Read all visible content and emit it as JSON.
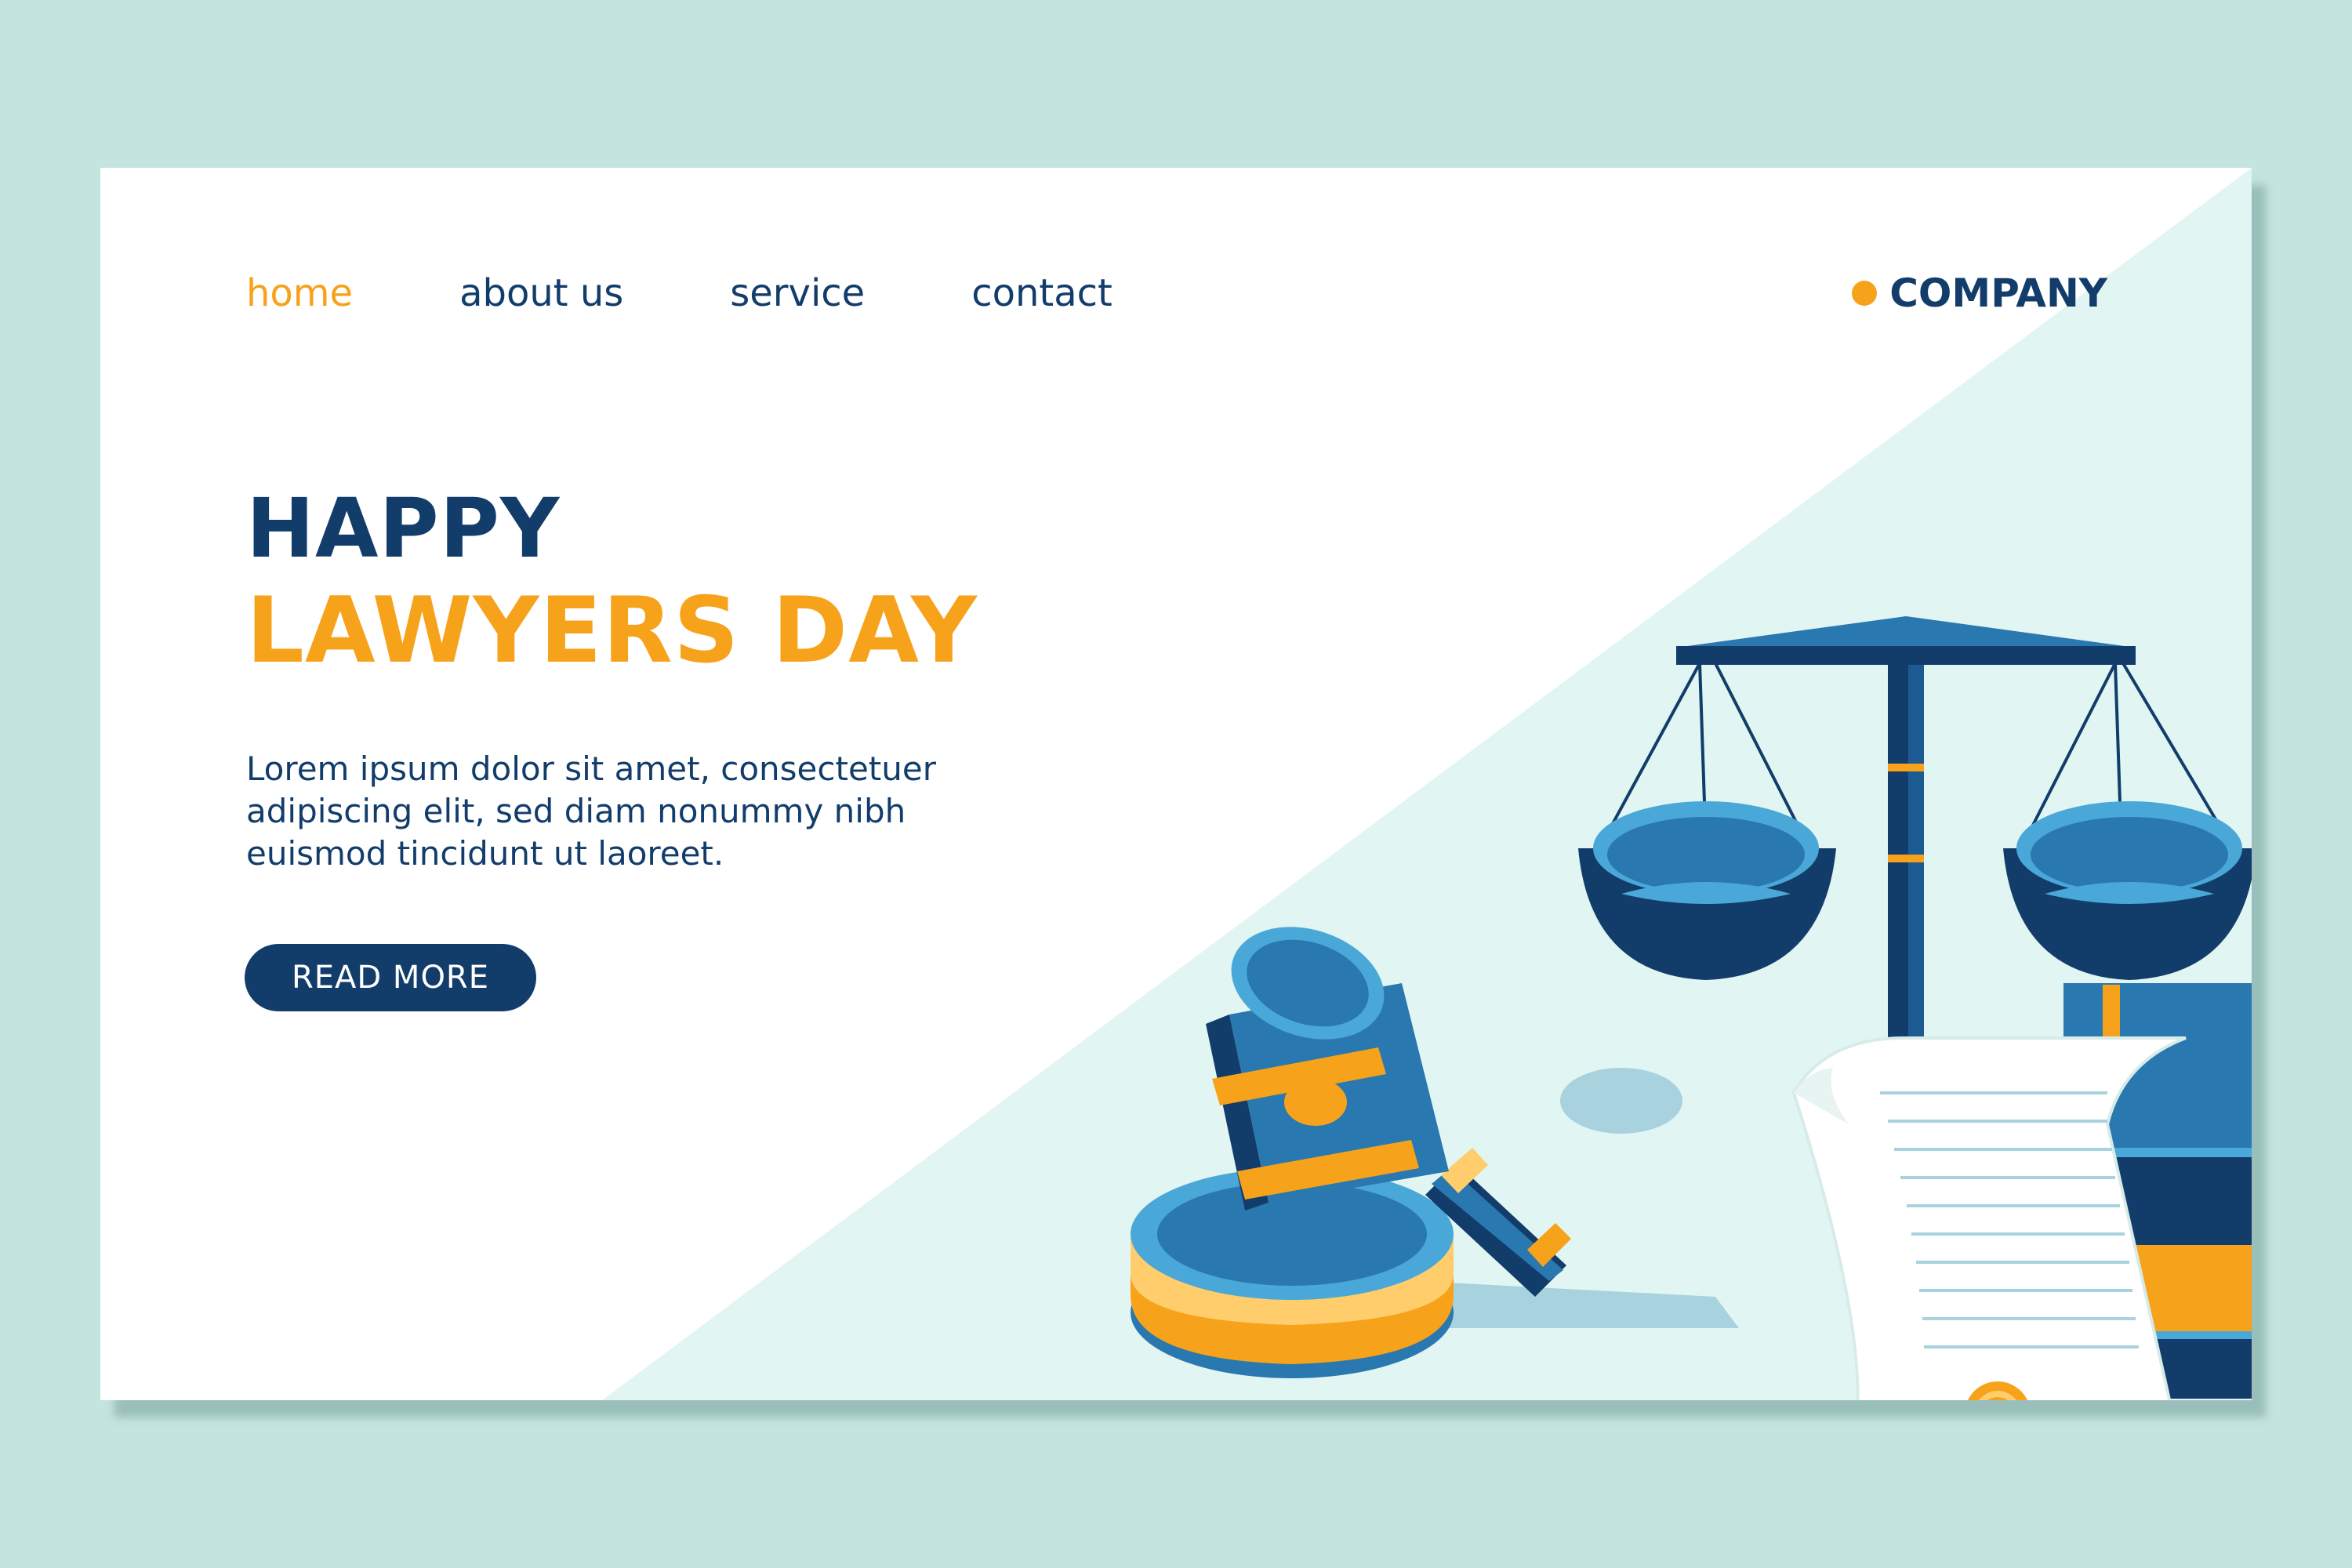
{
  "nav": {
    "items": [
      {
        "label": "home",
        "active": true
      },
      {
        "label": "about us",
        "active": false
      },
      {
        "label": "service",
        "active": false
      },
      {
        "label": "contact",
        "active": false
      }
    ]
  },
  "brand": {
    "name": "COMPANY",
    "dot_color": "#f7a21b"
  },
  "hero": {
    "title_line1": "HAPPY",
    "title_line2": "LAWYERS DAY",
    "body": "Lorem ipsum dolor sit amet, consectetuer adipiscing elit, sed diam nonummy nibh euismod tincidunt ut laoreet.",
    "cta_label": "READ MORE"
  },
  "illustration": {
    "icons": [
      "scales-of-justice-icon",
      "gavel-icon",
      "law-books-icon",
      "scroll-document-icon",
      "wax-seal-icon"
    ]
  },
  "colors": {
    "navy": "#123d6b",
    "orange": "#f7a21b",
    "blue": "#2a78b0",
    "light_blue": "#4aa8d8",
    "mint": "#e1f5f2",
    "page_bg": "#c4e4df"
  }
}
